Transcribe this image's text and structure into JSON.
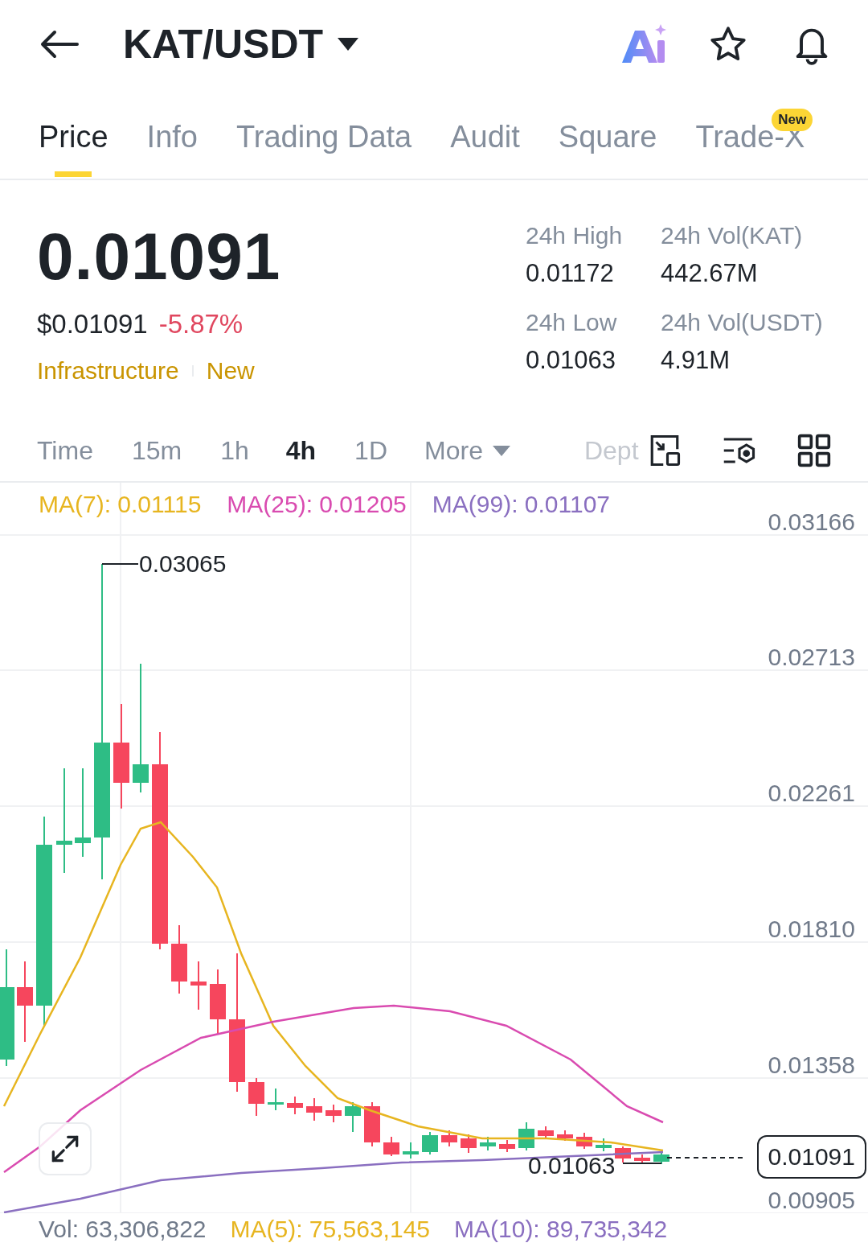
{
  "header": {
    "title": "KAT/USDT"
  },
  "tabs": [
    {
      "label": "Price",
      "selected": true
    },
    {
      "label": "Info",
      "selected": false
    },
    {
      "label": "Trading Data",
      "selected": false
    },
    {
      "label": "Audit",
      "selected": false
    },
    {
      "label": "Square",
      "selected": false
    },
    {
      "label": "Trade-X",
      "selected": false,
      "badge": "New"
    }
  ],
  "ticker": {
    "price": "0.01091",
    "usd_price": "$0.01091",
    "change": "-5.87%",
    "tags": [
      "Infrastructure",
      "New"
    ]
  },
  "stats": [
    {
      "label": "24h High",
      "value": "0.01172"
    },
    {
      "label": "24h Vol(KAT)",
      "value": "442.67M"
    },
    {
      "label": "24h Low",
      "value": "0.01063"
    },
    {
      "label": "24h Vol(USDT)",
      "value": "4.91M"
    }
  ],
  "intervals": [
    {
      "label": "Time",
      "selected": false
    },
    {
      "label": "15m",
      "selected": false
    },
    {
      "label": "1h",
      "selected": false
    },
    {
      "label": "4h",
      "selected": true
    },
    {
      "label": "1D",
      "selected": false
    }
  ],
  "more": {
    "label": "More"
  },
  "depth_tab": {
    "label": "Dept"
  },
  "ma_legend": [
    {
      "label": "MA(7): 0.01115",
      "color": "#e7b520"
    },
    {
      "label": "MA(25): 0.01205",
      "color": "#d94bb0"
    },
    {
      "label": "MA(99): 0.01107",
      "color": "#8a6fc0"
    }
  ],
  "price_axis": [
    "0.03166",
    "0.02713",
    "0.02261",
    "0.01810",
    "0.01358",
    "0.00905"
  ],
  "high_marker": "0.03065",
  "low_marker": "0.01063",
  "current_price": "0.01091",
  "volume_legend": [
    {
      "label": "Vol: 63,306,822",
      "color": "#707a8a"
    },
    {
      "label": "MA(5): 75,563,145",
      "color": "#e7b520"
    },
    {
      "label": "MA(10): 89,735,342",
      "color": "#8a6fc0"
    }
  ]
}
